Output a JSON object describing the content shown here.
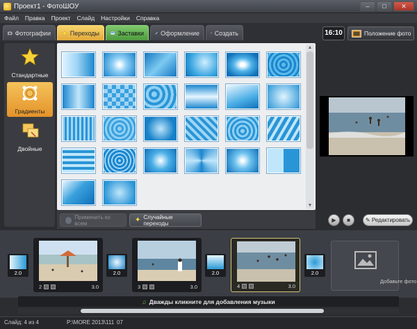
{
  "window": {
    "title": "Проект1 - ФотоШОУ",
    "buttons": [
      "–",
      "□",
      "✕"
    ]
  },
  "menu": [
    "Файл",
    "Правка",
    "Проект",
    "Слайд",
    "Настройки",
    "Справка"
  ],
  "tabs": [
    "Фотографии",
    "Переходы",
    "Заставки",
    "Оформление",
    "Создать"
  ],
  "active_tab": "Переходы",
  "time": "16:10",
  "photo_position_label": "Положение фото",
  "categories": [
    "Стандартные",
    "Градиенты",
    "Двойные"
  ],
  "active_category": "Градиенты",
  "buttons": {
    "apply_all": "Применить ко всем",
    "random": "Случайные переходы"
  },
  "edit_button": "Редактировать",
  "timeline": {
    "slides": [
      {
        "number": "2",
        "duration": "3.0"
      },
      {
        "number": "3",
        "duration": "3.0"
      },
      {
        "number": "4",
        "duration": "3.0"
      }
    ],
    "transition_durations": [
      "2.0",
      "2.0",
      "2.0",
      "2.0"
    ],
    "add_photo": "Добавьте фото",
    "music_hint": "Дважды кликните для добавления музыки"
  },
  "status": {
    "slide": "Слайд: 4 из 4",
    "path": "P:\\MORE 2013\\111",
    "code": "07"
  }
}
